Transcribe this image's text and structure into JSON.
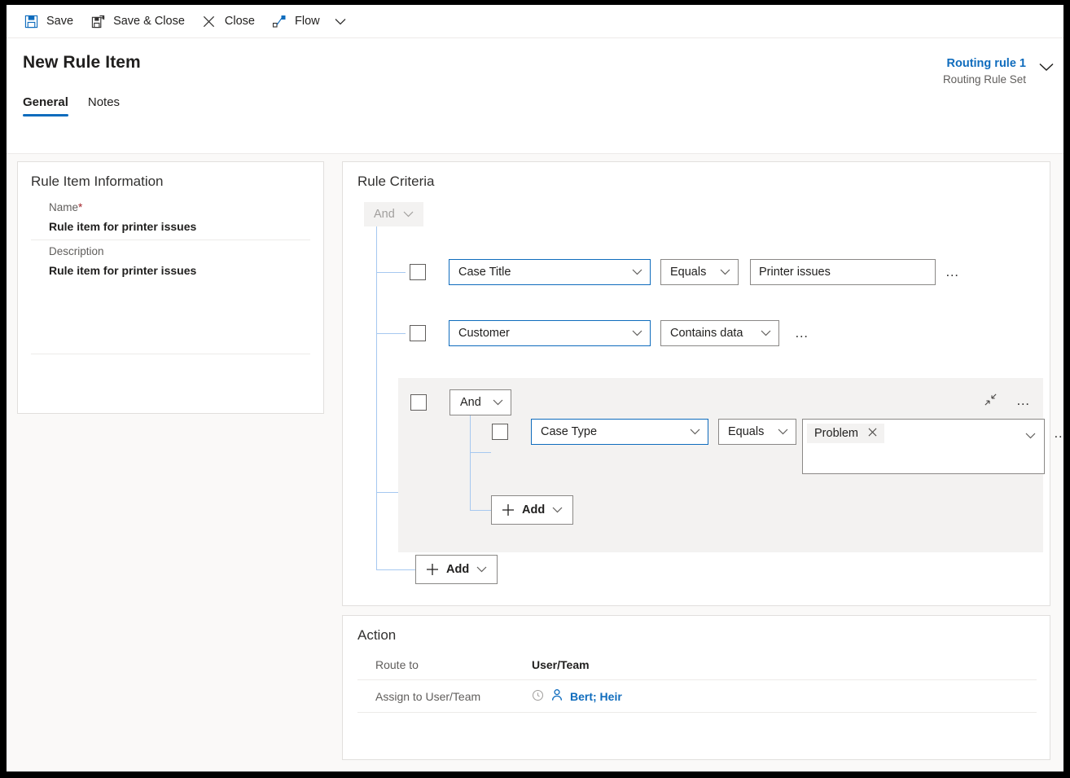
{
  "toolbar": {
    "items": [
      {
        "label": "Save",
        "icon": "save-icon"
      },
      {
        "label": "Save & Close",
        "icon": "save-and-close-icon"
      },
      {
        "label": "Close",
        "icon": "close-x-icon"
      },
      {
        "label": "Flow",
        "icon": "flow-icon"
      }
    ],
    "overflow_chevron": "chevron-down-icon"
  },
  "header": {
    "title": "New Rule Item",
    "record_link": "Routing rule 1",
    "record_subtitle": "Routing Rule Set",
    "collapse_chevron": "chevron-down-icon",
    "tabs": [
      {
        "label": "General",
        "active": true
      },
      {
        "label": "Notes",
        "active": false
      }
    ]
  },
  "rule_item_information": {
    "section_title": "Rule Item Information",
    "fields": [
      {
        "label": "Name",
        "required": true,
        "required_marker": "*",
        "value": "Rule item for printer issues"
      },
      {
        "label": "Description",
        "required": false,
        "value": "Rule item for printer issues"
      }
    ]
  },
  "rule_criteria": {
    "section_title": "Rule Criteria",
    "root_operator": {
      "label": "And",
      "chevron": "chevron-down-icon",
      "disabled": true
    },
    "conditions": [
      {
        "attribute": "Case Title",
        "operator": "Equals",
        "value": "Printer issues",
        "value_kind": "text",
        "more_label": "…"
      },
      {
        "attribute": "Customer",
        "operator": "Contains data",
        "value": "",
        "value_kind": "none",
        "more_label": "…"
      }
    ],
    "group": {
      "operator": {
        "label": "And",
        "chevron": "chevron-down-icon"
      },
      "collapse_icon": "collapse-arrows-icon",
      "more_label": "…",
      "conditions": [
        {
          "attribute": "Case Type",
          "operator": "Equals",
          "value_kind": "tags",
          "tags": [
            {
              "label": "Problem",
              "remove_icon": "close-x-icon"
            }
          ],
          "more_label": "…"
        }
      ],
      "add_button": {
        "label": "Add",
        "plus_icon": "plus-icon",
        "chevron": "chevron-down-icon"
      }
    },
    "add_button": {
      "label": "Add",
      "plus_icon": "plus-icon",
      "chevron": "chevron-down-icon"
    }
  },
  "action": {
    "section_title": "Action",
    "rows": [
      {
        "label": "Route to",
        "value": "User/Team",
        "kind": "bold-text"
      },
      {
        "label": "Assign to User/Team",
        "value": "Bert; Heir",
        "kind": "lookup",
        "lookup_icons": [
          "recent-items-icon",
          "contact-person-icon"
        ]
      }
    ]
  },
  "colors": {
    "accent": "#0f6cbd",
    "required": "#a4262c",
    "tree_line": "#a6c8f0",
    "panel_bg": "#faf9f8",
    "group_bg": "#f3f2f1",
    "border": "#e1dfdd"
  }
}
